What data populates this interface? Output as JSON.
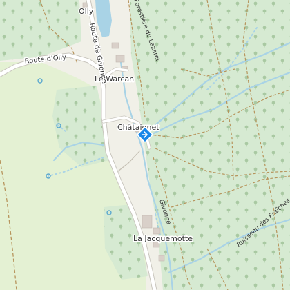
{
  "map": {
    "places": {
      "olly": "Olly",
      "le_warcan": "Le Warcan",
      "chataignet": "Châtaignet",
      "la_jacquemotte": "La Jacquemotte"
    },
    "roads": {
      "route_d_olly": "Route d'Olly",
      "route_de_givonne": "Route de Givonne",
      "forestiere_du_lazaret": "Forestière du Lazaret"
    },
    "water": {
      "givonne": "Givonne",
      "ruisseau_des_fraiches": "Ruisseau des Fraîches"
    },
    "marker": {
      "icon": "location-diamond-icon",
      "color": "#1a88e8"
    },
    "colors": {
      "forest": "#d6ead2",
      "meadow": "#e4f1d3",
      "water": "#a9d3e6",
      "road": "#ffffff",
      "road_casing": "#c9c6be",
      "track": "#b7945c"
    }
  }
}
